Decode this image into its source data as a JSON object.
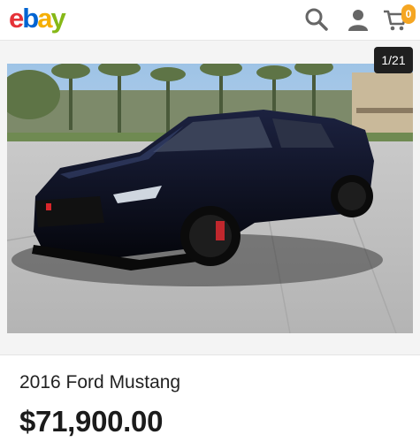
{
  "header": {
    "logo_letters": [
      {
        "char": "e",
        "color": "#e53238"
      },
      {
        "char": "b",
        "color": "#0064d2"
      },
      {
        "char": "a",
        "color": "#f5af02"
      },
      {
        "char": "y",
        "color": "#86b817"
      }
    ],
    "search_icon": "search-icon",
    "account_icon": "user-icon",
    "cart_icon": "cart-icon",
    "cart_count": "0"
  },
  "gallery": {
    "counter": "1/21"
  },
  "listing": {
    "title": "2016 Ford Mustang",
    "price": "$71,900.00"
  },
  "colors": {
    "badge": "#f5a623",
    "icon_gray": "#666666"
  }
}
